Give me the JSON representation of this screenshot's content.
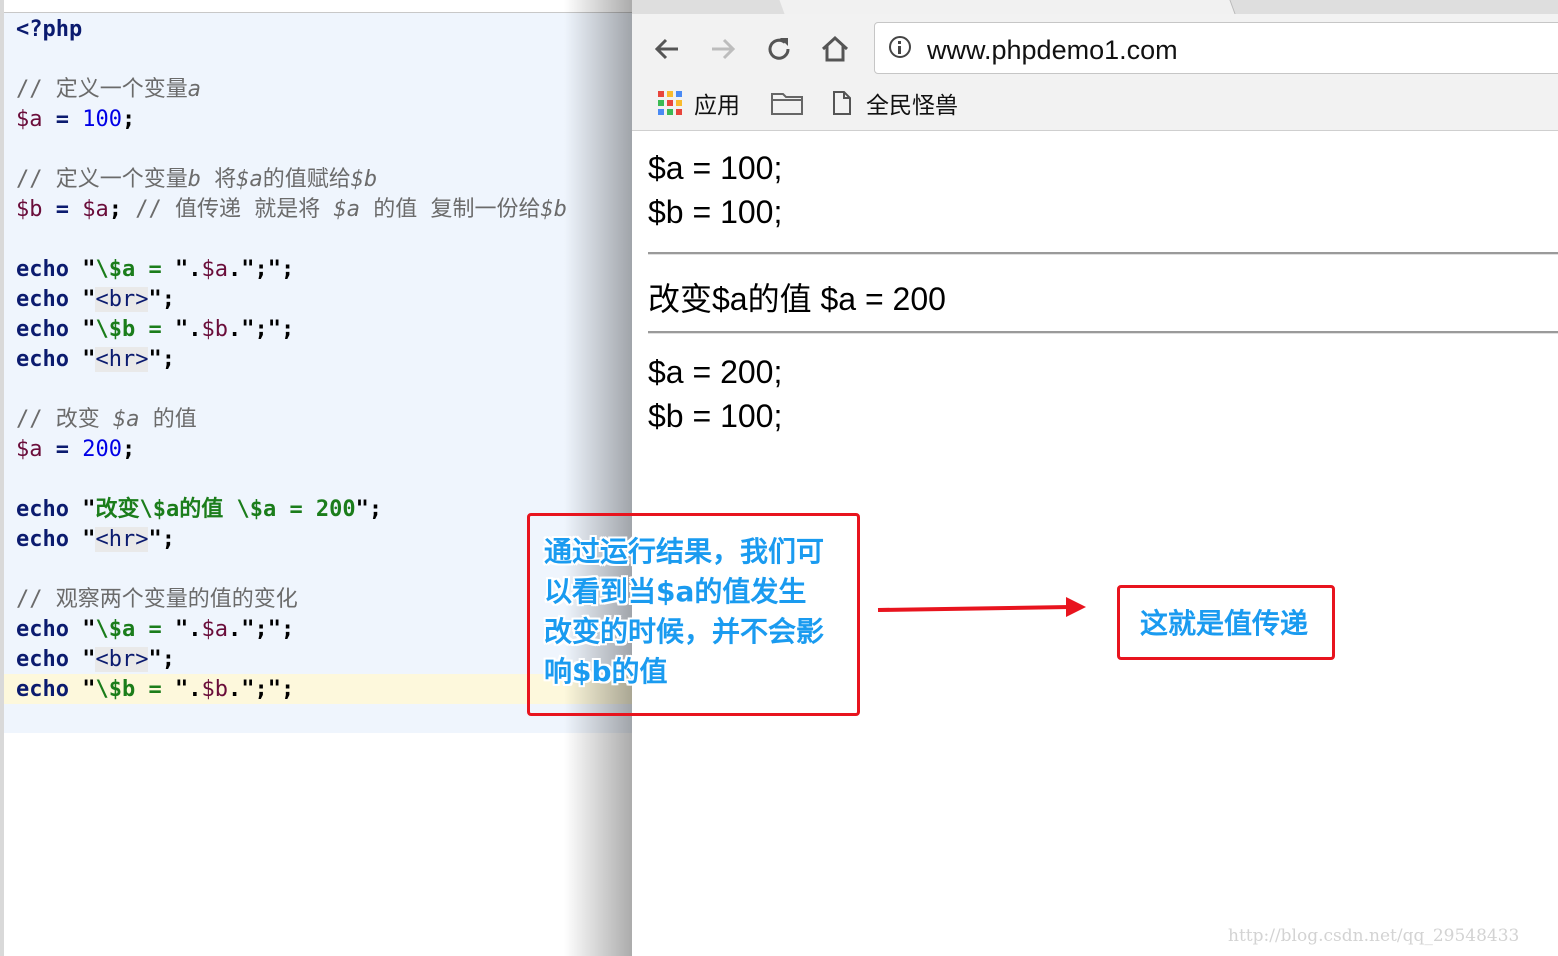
{
  "editor": {
    "lines": [
      {
        "tokens": [
          {
            "t": "<?php",
            "c": "php"
          }
        ]
      },
      {
        "tokens": []
      },
      {
        "tokens": [
          {
            "t": "// 定义一个变量",
            "c": "com"
          },
          {
            "t": "a",
            "c": "comv"
          }
        ]
      },
      {
        "tokens": [
          {
            "t": "$a",
            "c": "var"
          },
          {
            "t": " = ",
            "c": "kw"
          },
          {
            "t": "100",
            "c": "num"
          },
          {
            "t": ";",
            "c": "punc"
          }
        ]
      },
      {
        "tokens": []
      },
      {
        "tokens": [
          {
            "t": "// 定义一个变量",
            "c": "com"
          },
          {
            "t": "b",
            "c": "comv"
          },
          {
            "t": " 将",
            "c": "com"
          },
          {
            "t": "$a",
            "c": "comv"
          },
          {
            "t": "的值赋给",
            "c": "com"
          },
          {
            "t": "$b",
            "c": "comv"
          }
        ]
      },
      {
        "tokens": [
          {
            "t": "$b",
            "c": "var"
          },
          {
            "t": " = ",
            "c": "kw"
          },
          {
            "t": "$a",
            "c": "var"
          },
          {
            "t": ";",
            "c": "punc"
          },
          {
            "t": " // 值传递 就是将 ",
            "c": "com"
          },
          {
            "t": "$a",
            "c": "comv"
          },
          {
            "t": " 的值 复制一份给",
            "c": "com"
          },
          {
            "t": "$b",
            "c": "comv"
          }
        ]
      },
      {
        "tokens": []
      },
      {
        "tokens": [
          {
            "t": "echo",
            "c": "kw"
          },
          {
            "t": " \"",
            "c": "punc"
          },
          {
            "t": "\\$a",
            "c": "str"
          },
          {
            "t": " = ",
            "c": "str"
          },
          {
            "t": "\".",
            "c": "punc"
          },
          {
            "t": "$a",
            "c": "strv"
          },
          {
            "t": ".\";\";",
            "c": "punc"
          }
        ]
      },
      {
        "tokens": [
          {
            "t": "echo",
            "c": "kw"
          },
          {
            "t": " \"",
            "c": "punc"
          },
          {
            "t": "<br>",
            "c": "tagbox"
          },
          {
            "t": "\";",
            "c": "punc"
          }
        ]
      },
      {
        "tokens": [
          {
            "t": "echo",
            "c": "kw"
          },
          {
            "t": " \"",
            "c": "punc"
          },
          {
            "t": "\\$b",
            "c": "str"
          },
          {
            "t": " = ",
            "c": "str"
          },
          {
            "t": "\".",
            "c": "punc"
          },
          {
            "t": "$b",
            "c": "strv"
          },
          {
            "t": ".\";\";",
            "c": "punc"
          }
        ]
      },
      {
        "tokens": [
          {
            "t": "echo",
            "c": "kw"
          },
          {
            "t": " \"",
            "c": "punc"
          },
          {
            "t": "<hr>",
            "c": "tagbox"
          },
          {
            "t": "\";",
            "c": "punc"
          }
        ]
      },
      {
        "tokens": []
      },
      {
        "tokens": [
          {
            "t": "// 改变 ",
            "c": "com"
          },
          {
            "t": "$a",
            "c": "comv"
          },
          {
            "t": " 的值",
            "c": "com"
          }
        ]
      },
      {
        "tokens": [
          {
            "t": "$a",
            "c": "var"
          },
          {
            "t": " = ",
            "c": "kw"
          },
          {
            "t": "200",
            "c": "num"
          },
          {
            "t": ";",
            "c": "punc"
          }
        ]
      },
      {
        "tokens": []
      },
      {
        "tokens": [
          {
            "t": "echo",
            "c": "kw"
          },
          {
            "t": " \"",
            "c": "punc"
          },
          {
            "t": "改变\\$a的值 \\$a = 200",
            "c": "str"
          },
          {
            "t": "\";",
            "c": "punc"
          }
        ]
      },
      {
        "tokens": [
          {
            "t": "echo",
            "c": "kw"
          },
          {
            "t": " \"",
            "c": "punc"
          },
          {
            "t": "<hr>",
            "c": "tagbox"
          },
          {
            "t": "\";",
            "c": "punc"
          }
        ]
      },
      {
        "tokens": []
      },
      {
        "tokens": [
          {
            "t": "// 观察两个变量的值的变化",
            "c": "com"
          }
        ]
      },
      {
        "tokens": [
          {
            "t": "echo",
            "c": "kw"
          },
          {
            "t": " \"",
            "c": "punc"
          },
          {
            "t": "\\$a",
            "c": "str"
          },
          {
            "t": " = ",
            "c": "str"
          },
          {
            "t": "\".",
            "c": "punc"
          },
          {
            "t": "$a",
            "c": "strv"
          },
          {
            "t": ".\";\";",
            "c": "punc"
          }
        ]
      },
      {
        "tokens": [
          {
            "t": "echo",
            "c": "kw"
          },
          {
            "t": " \"",
            "c": "punc"
          },
          {
            "t": "<br>",
            "c": "tagbox"
          },
          {
            "t": "\";",
            "c": "punc"
          }
        ]
      },
      {
        "tokens": [
          {
            "t": "echo",
            "c": "kw"
          },
          {
            "t": " \"",
            "c": "punc"
          },
          {
            "t": "\\$b",
            "c": "str"
          },
          {
            "t": " = ",
            "c": "str"
          },
          {
            "t": "\".",
            "c": "punc"
          },
          {
            "t": "$b",
            "c": "strv"
          },
          {
            "t": ".\";\";",
            "c": "punc"
          }
        ]
      }
    ]
  },
  "browser": {
    "url": "www.phpdemo1.com",
    "bookmarks": {
      "apps_label": "应用",
      "page_label": "全民怪兽"
    },
    "apps_colors": [
      "#e8453c",
      "#f9bb2d",
      "#4a8af4",
      "#3cba54",
      "#e8453c",
      "#f9bb2d",
      "#4a8af4",
      "#3cba54",
      "#e8453c"
    ],
    "output": {
      "line1": "$a = 100;",
      "line2": "$b = 100;",
      "line3": "改变$a的值 $a = 200",
      "line4": "$a = 200;",
      "line5": "$b = 100;"
    },
    "watermark": "http://blog.csdn.net/qq_29548433"
  },
  "annotations": {
    "left_text": [
      "通过运行结果，我们可",
      "以看到当$a的值发生",
      "改变的时候，并不会影",
      "响$b的值"
    ],
    "right_text": "这就是值传递",
    "border_color": "#e8141e",
    "text_color": "#1a9bf0"
  }
}
